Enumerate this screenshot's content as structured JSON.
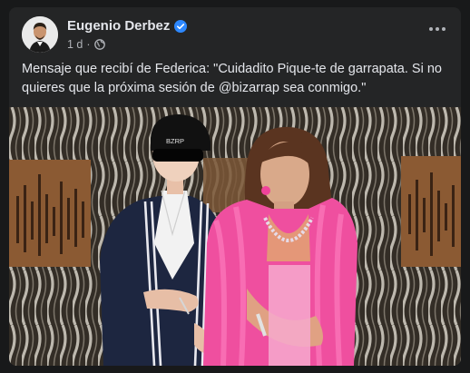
{
  "post": {
    "author": "Eugenio Derbez",
    "verified": true,
    "time": "1 d",
    "separator": "·",
    "audience_icon": "globe-icon",
    "more_icon": "ellipsis-icon",
    "text": "Mensaje que recibí de Federica: \"Cuidadito Pique-te de garrapata. Si no quieres que la próxima sesión de @bizarrap sea conmigo.\"",
    "image": {
      "hat_text": "BZRP"
    }
  },
  "colors": {
    "background": "#18191a",
    "card": "#242526",
    "primary_text": "#e4e6eb",
    "secondary_text": "#b0b3b8",
    "verified_blue": "#2d88ff",
    "pink_outfit": "#f0439a"
  }
}
